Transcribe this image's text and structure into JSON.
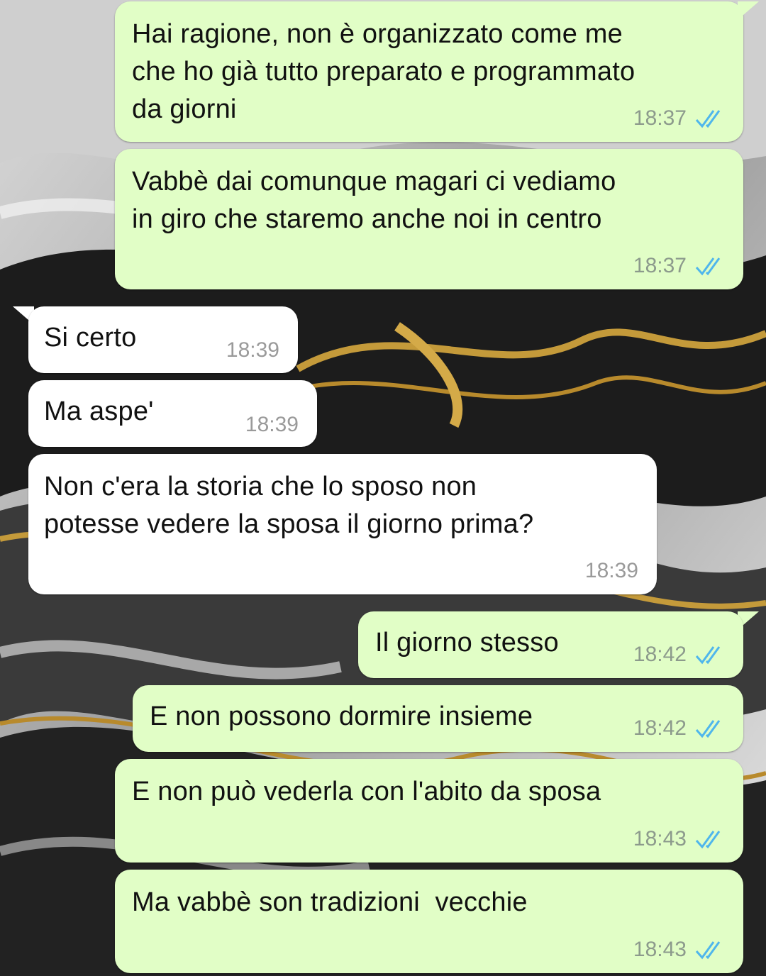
{
  "theme": {
    "outgoing_bubble": "#e1fec6",
    "incoming_bubble": "#ffffff",
    "read_tick": "#4fb6ec"
  },
  "messages": [
    {
      "direction": "out",
      "lines": [
        "Hai ragione, non è organizzato come me",
        "che ho già tutto preparato e programmato",
        "da giorni"
      ],
      "time": "18:37",
      "status": "read-ticks-icon"
    },
    {
      "direction": "out",
      "lines": [
        "Vabbè dai comunque magari ci vediamo",
        "in giro che staremo anche noi in centro"
      ],
      "time": "18:37",
      "status": "read-ticks-icon"
    },
    {
      "direction": "in",
      "lines": [
        "Si certo"
      ],
      "time": "18:39"
    },
    {
      "direction": "in",
      "lines": [
        "Ma aspe'"
      ],
      "time": "18:39"
    },
    {
      "direction": "in",
      "lines": [
        "Non c'era la storia che lo sposo non",
        "potesse vedere la sposa il giorno prima?"
      ],
      "time": "18:39"
    },
    {
      "direction": "out",
      "lines": [
        "Il giorno stesso"
      ],
      "time": "18:42",
      "status": "read-ticks-icon"
    },
    {
      "direction": "out",
      "lines": [
        "E non possono dormire insieme"
      ],
      "time": "18:42",
      "status": "read-ticks-icon"
    },
    {
      "direction": "out",
      "lines": [
        "E non può vederla con l'abito da sposa"
      ],
      "time": "18:43",
      "status": "read-ticks-icon"
    },
    {
      "direction": "out",
      "lines": [
        "Ma vabbè son tradizioni  vecchie"
      ],
      "time": "18:43",
      "status": "read-ticks-icon"
    }
  ]
}
